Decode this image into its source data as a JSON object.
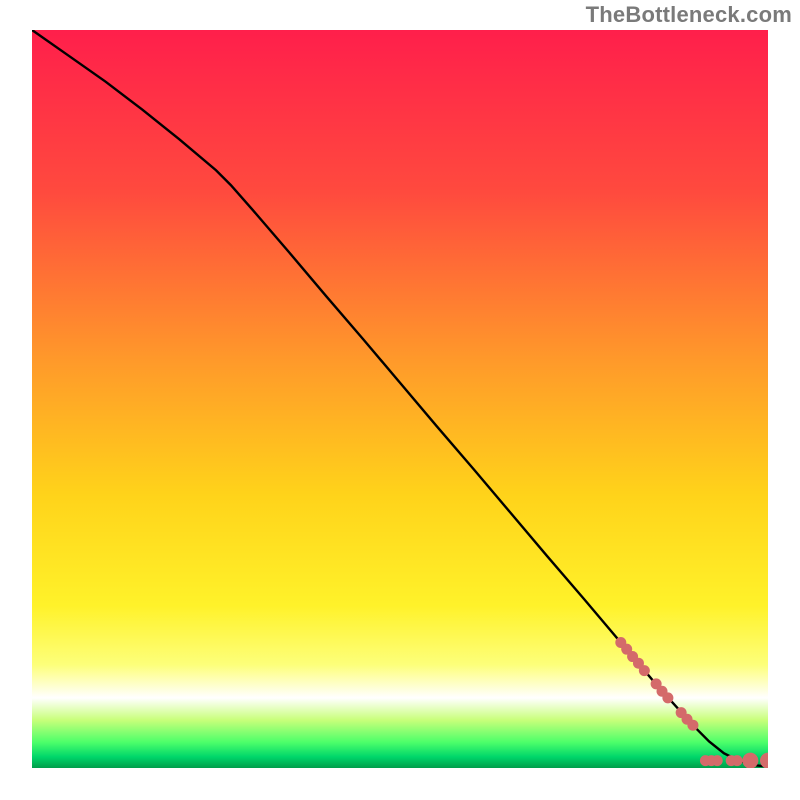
{
  "watermark": "TheBottleneck.com",
  "chart_data": {
    "type": "line",
    "title": "",
    "xlabel": "",
    "ylabel": "",
    "xlim": [
      0,
      100
    ],
    "ylim": [
      0,
      100
    ],
    "grid": false,
    "legend": false,
    "background_gradient_stops": [
      {
        "offset": 0.0,
        "color": "#ff1f4b"
      },
      {
        "offset": 0.22,
        "color": "#ff4a3e"
      },
      {
        "offset": 0.45,
        "color": "#ff9a2a"
      },
      {
        "offset": 0.63,
        "color": "#ffd31a"
      },
      {
        "offset": 0.78,
        "color": "#fff22a"
      },
      {
        "offset": 0.86,
        "color": "#fdff7a"
      },
      {
        "offset": 0.905,
        "color": "#ffffff"
      },
      {
        "offset": 0.935,
        "color": "#c8ff7a"
      },
      {
        "offset": 0.965,
        "color": "#4dff6a"
      },
      {
        "offset": 0.985,
        "color": "#00d66a"
      },
      {
        "offset": 1.0,
        "color": "#009e4a"
      }
    ],
    "series": [
      {
        "name": "curve",
        "type": "line",
        "color": "#000000",
        "width": 2.4,
        "x": [
          0,
          5,
          10,
          15,
          20,
          25,
          27,
          30,
          35,
          40,
          45,
          50,
          55,
          60,
          65,
          70,
          75,
          80,
          85,
          86,
          88,
          90,
          92,
          94,
          96,
          98,
          100
        ],
        "y": [
          100,
          96.5,
          93,
          89.2,
          85.2,
          81,
          79,
          75.6,
          69.8,
          63.9,
          58.1,
          52.2,
          46.3,
          40.5,
          34.6,
          28.7,
          22.9,
          17.0,
          11.1,
          10.0,
          7.8,
          5.6,
          3.6,
          2.0,
          1.0,
          0.4,
          0.2
        ]
      },
      {
        "name": "markers",
        "type": "scatter",
        "color": "#d46a6a",
        "radius_small": 5.5,
        "radius_large": 8,
        "points": [
          {
            "x": 80.0,
            "y": 17.0,
            "r": "small"
          },
          {
            "x": 80.8,
            "y": 16.1,
            "r": "small"
          },
          {
            "x": 81.6,
            "y": 15.1,
            "r": "small"
          },
          {
            "x": 82.4,
            "y": 14.2,
            "r": "small"
          },
          {
            "x": 83.2,
            "y": 13.2,
            "r": "small"
          },
          {
            "x": 84.8,
            "y": 11.4,
            "r": "small"
          },
          {
            "x": 85.6,
            "y": 10.4,
            "r": "small"
          },
          {
            "x": 86.4,
            "y": 9.5,
            "r": "small"
          },
          {
            "x": 88.2,
            "y": 7.5,
            "r": "small"
          },
          {
            "x": 89.0,
            "y": 6.6,
            "r": "small"
          },
          {
            "x": 89.8,
            "y": 5.8,
            "r": "small"
          },
          {
            "x": 91.5,
            "y": 1.0,
            "r": "small"
          },
          {
            "x": 92.3,
            "y": 1.0,
            "r": "small"
          },
          {
            "x": 93.1,
            "y": 1.0,
            "r": "small"
          },
          {
            "x": 95.0,
            "y": 1.0,
            "r": "small"
          },
          {
            "x": 95.8,
            "y": 1.0,
            "r": "small"
          },
          {
            "x": 97.6,
            "y": 1.0,
            "r": "large"
          },
          {
            "x": 100.0,
            "y": 1.0,
            "r": "large"
          }
        ]
      }
    ]
  }
}
